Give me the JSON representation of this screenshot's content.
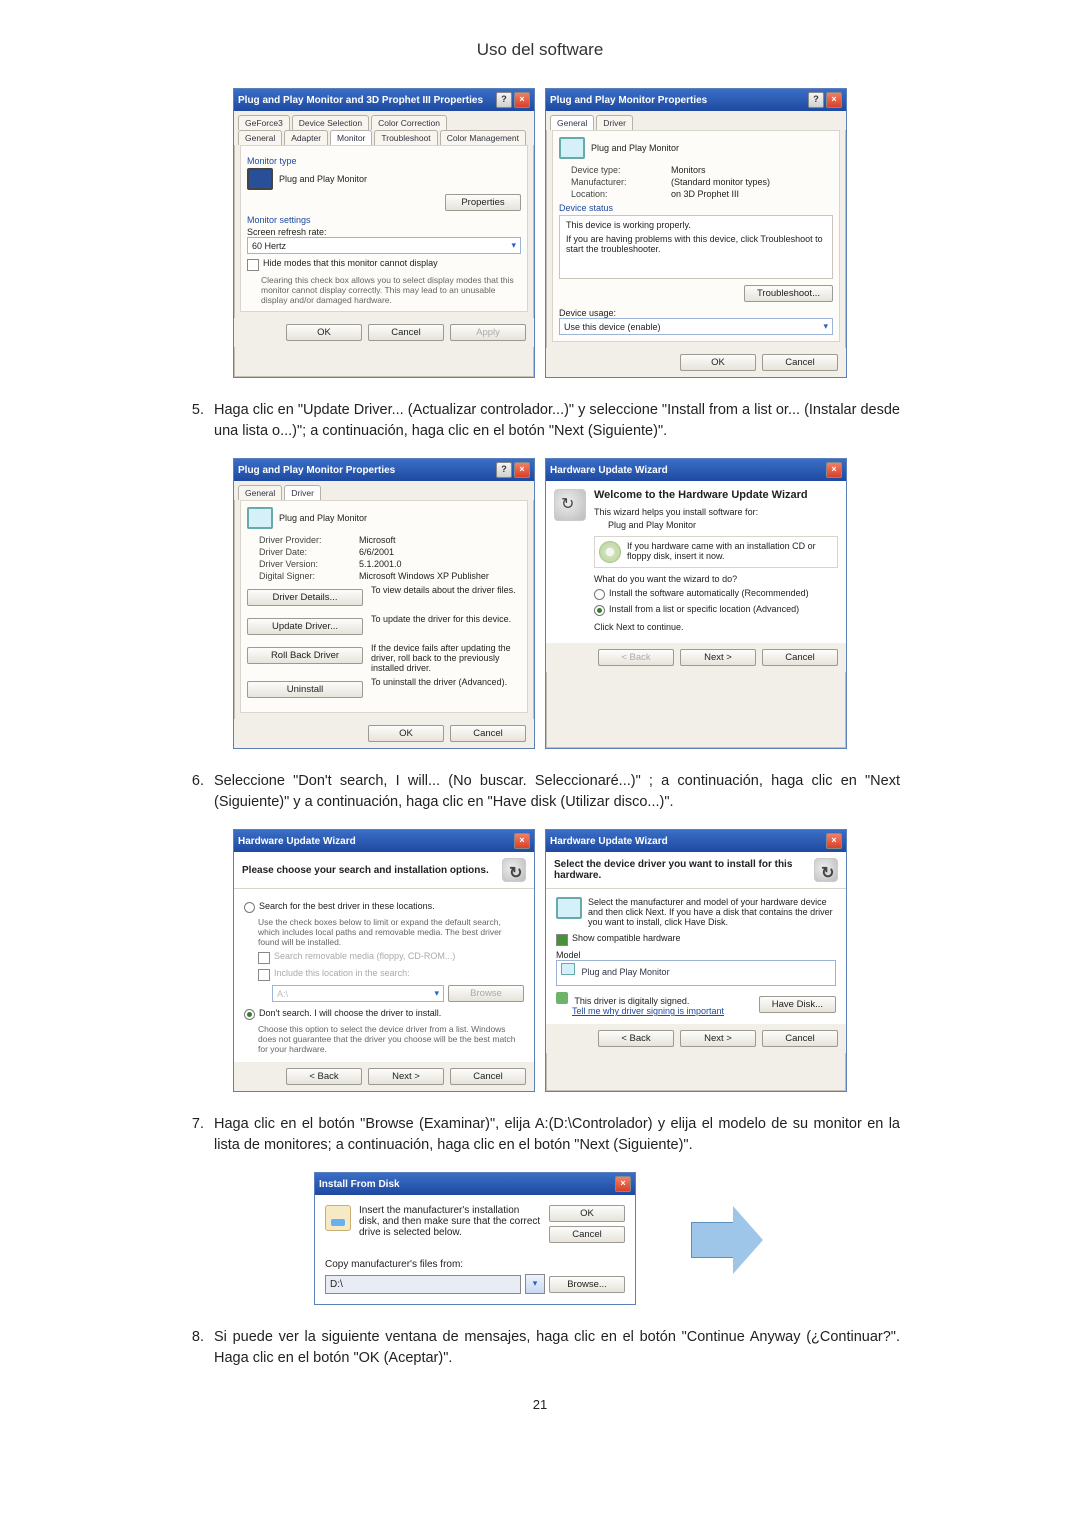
{
  "page_title": "Uso del software",
  "page_number": "21",
  "step5": {
    "num": "5.",
    "text": "Haga clic en \"Update Driver... (Actualizar controlador...)\" y seleccione \"Install from a list or... (Instalar desde una lista o...)\"; a continuación, haga clic en el botón \"Next (Siguiente)\"."
  },
  "step6": {
    "num": "6.",
    "text": "Seleccione \"Don't search, I will... (No buscar. Seleccionaré...)\" ; a continuación, haga clic en \"Next (Siguiente)\" y a continuación, haga clic en \"Have disk (Utilizar disco...)\"."
  },
  "step7": {
    "num": "7.",
    "text": "Haga clic en el botón \"Browse (Examinar)\", elija A:(D:\\Controlador) y elija el modelo de su monitor en la lista de monitores; a continuación, haga clic en el botón \"Next (Siguiente)\"."
  },
  "step8": {
    "num": "8.",
    "text": "Si puede ver la siguiente ventana de mensajes, haga clic en el botón \"Continue Anyway (¿Continuar?\". Haga clic en el botón \"OK (Aceptar)\"."
  },
  "common_btns": {
    "ok": "OK",
    "cancel": "Cancel",
    "apply_disabled": "Apply",
    "back": "< Back",
    "next": "Next >",
    "browse": "Browse..."
  },
  "dlg1a": {
    "title": "Plug and Play Monitor and 3D Prophet III Properties",
    "tabs_row1": [
      "GeForce3",
      "Device Selection",
      "Color Correction"
    ],
    "tabs_row2": [
      "General",
      "Adapter",
      "Monitor",
      "Troubleshoot",
      "Color Management"
    ],
    "monitor_type_label": "Monitor type",
    "monitor_type_value": "Plug and Play Monitor",
    "properties_btn": "Properties",
    "monitor_settings_label": "Monitor settings",
    "refresh_label": "Screen refresh rate:",
    "refresh_value": "60 Hertz",
    "hide_modes": "Hide modes that this monitor cannot display",
    "hide_hint": "Clearing this check box allows you to select display modes that this monitor cannot display correctly. This may lead to an unusable display and/or damaged hardware."
  },
  "dlg1b": {
    "title": "Plug and Play Monitor Properties",
    "tabs": [
      "General",
      "Driver"
    ],
    "device_name": "Plug and Play Monitor",
    "device_type_label": "Device type:",
    "device_type_value": "Monitors",
    "manufacturer_label": "Manufacturer:",
    "manufacturer_value": "(Standard monitor types)",
    "location_label": "Location:",
    "location_value": "on 3D Prophet III",
    "status_title": "Device status",
    "status_line1": "This device is working properly.",
    "status_line2": "If you are having problems with this device, click Troubleshoot to start the troubleshooter.",
    "troubleshoot_btn": "Troubleshoot...",
    "usage_label": "Device usage:",
    "usage_value": "Use this device (enable)"
  },
  "dlg2a": {
    "title": "Plug and Play Monitor Properties",
    "tabs": [
      "General",
      "Driver"
    ],
    "device_name": "Plug and Play Monitor",
    "provider_label": "Driver Provider:",
    "provider_value": "Microsoft",
    "date_label": "Driver Date:",
    "date_value": "6/6/2001",
    "version_label": "Driver Version:",
    "version_value": "5.1.2001.0",
    "signer_label": "Digital Signer:",
    "signer_value": "Microsoft Windows XP Publisher",
    "btn_details": "Driver Details...",
    "btn_update": "Update Driver...",
    "btn_rollback": "Roll Back Driver",
    "btn_uninstall": "Uninstall",
    "desc_details": "To view details about the driver files.",
    "desc_update": "To update the driver for this device.",
    "desc_rollback": "If the device fails after updating the driver, roll back to the previously installed driver.",
    "desc_uninstall": "To uninstall the driver (Advanced)."
  },
  "dlg2b": {
    "title": "Hardware Update Wizard",
    "welcome": "Welcome to the Hardware Update Wizard",
    "intro": "This wizard helps you install software for:",
    "device": "Plug and Play Monitor",
    "cd_note": "If you hardware came with an installation CD or floppy disk, insert it now.",
    "what_do": "What do you want the wizard to do?",
    "opt_auto": "Install the software automatically (Recommended)",
    "opt_list": "Install from a list or specific location (Advanced)",
    "click_next": "Click Next to continue."
  },
  "dlg3a": {
    "title": "Hardware Update Wizard",
    "subhead": "Please choose your search and installation options.",
    "opt_search": "Search for the best driver in these locations.",
    "search_hint": "Use the check boxes below to limit or expand the default search, which includes local paths and removable media. The best driver found will be installed.",
    "chk_removable": "Search removable media (floppy, CD-ROM...)",
    "chk_include": "Include this location in the search:",
    "path_value": "A:\\",
    "browse_btn": "Browse",
    "opt_dont": "Don't search. I will choose the driver to install.",
    "dont_hint": "Choose this option to select the device driver from a list. Windows does not guarantee that the driver you choose will be the best match for your hardware."
  },
  "dlg3b": {
    "title": "Hardware Update Wizard",
    "subhead": "Select the device driver you want to install for this hardware.",
    "text": "Select the manufacturer and model of your hardware device and then click Next. If you have a disk that contains the driver you want to install, click Have Disk.",
    "show_compat": "Show compatible hardware",
    "model_label": "Model",
    "model_item": "Plug and Play Monitor",
    "signed": "This driver is digitally signed.",
    "tell_me": "Tell me why driver signing is important",
    "have_disk_btn": "Have Disk..."
  },
  "dlg4": {
    "title": "Install From Disk",
    "text": "Insert the manufacturer's installation disk, and then make sure that the correct drive is selected below.",
    "copy_label": "Copy manufacturer's files from:",
    "path_value": "D:\\"
  }
}
